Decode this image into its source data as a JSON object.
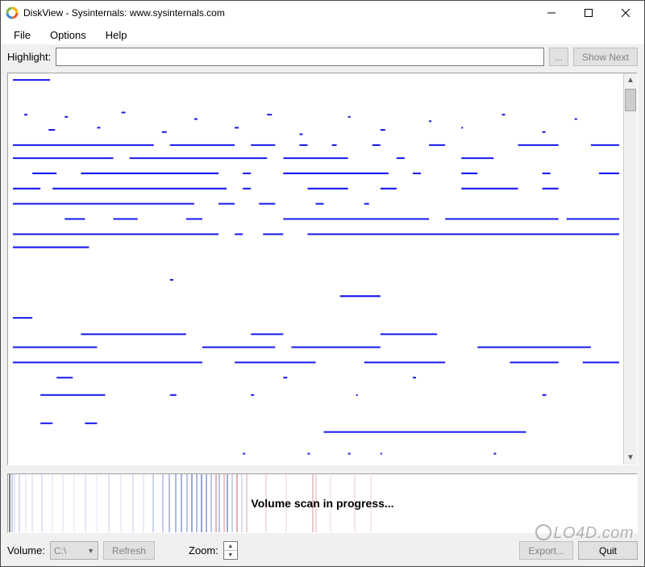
{
  "titlebar": {
    "icon_name": "diskview-icon",
    "title": "DiskView - Sysinternals: www.sysinternals.com"
  },
  "menu": {
    "file": "File",
    "options": "Options",
    "help": "Help"
  },
  "highlight": {
    "label": "Highlight:",
    "value": "",
    "browse_label": "...",
    "show_next_label": "Show Next"
  },
  "scan_status": "Volume scan in progress...",
  "bottom": {
    "volume_label": "Volume:",
    "volume_value": "C:\\",
    "refresh_label": "Refresh",
    "zoom_label": "Zoom:",
    "export_label": "Export...",
    "quit_label": "Quit"
  },
  "watermark": "LO4D.com"
}
